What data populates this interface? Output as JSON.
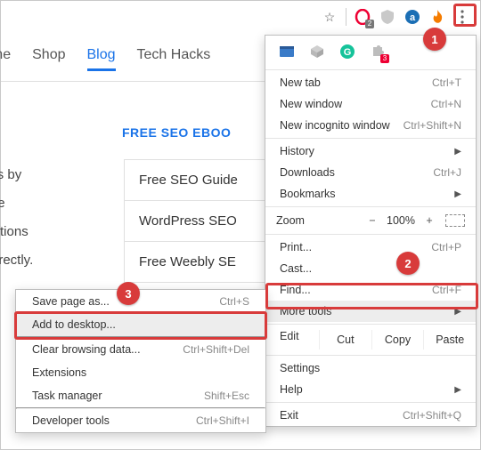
{
  "callouts": {
    "one": "1",
    "two": "2",
    "three": "3"
  },
  "toolbar": {
    "opera_badge": "2",
    "ext_badge": "3"
  },
  "nav": {
    "home": "ome",
    "shop": "Shop",
    "blog": "Blog",
    "hacks": "Tech Hacks"
  },
  "heading": "FREE SEO EBOO",
  "body": {
    "l1": "gers by",
    "l2": ". We",
    "l3": "tructions",
    "l4": "s directly."
  },
  "list": {
    "i1": "Free SEO Guide",
    "i2": "WordPress SEO",
    "i3": "Free Weebly SE"
  },
  "menu": {
    "new_tab": "New tab",
    "new_tab_sc": "Ctrl+T",
    "new_window": "New window",
    "new_window_sc": "Ctrl+N",
    "new_incognito": "New incognito window",
    "new_incognito_sc": "Ctrl+Shift+N",
    "history": "History",
    "downloads": "Downloads",
    "downloads_sc": "Ctrl+J",
    "bookmarks": "Bookmarks",
    "zoom": "Zoom",
    "zoom_minus": "−",
    "zoom_val": "100%",
    "zoom_plus": "+",
    "print": "Print...",
    "print_sc": "Ctrl+P",
    "cast": "Cast...",
    "find": "Find...",
    "find_sc": "Ctrl+F",
    "more_tools": "More tools",
    "edit": "Edit",
    "cut": "Cut",
    "copy": "Copy",
    "paste": "Paste",
    "settings": "Settings",
    "help": "Help",
    "exit": "Exit",
    "exit_sc": "Ctrl+Shift+Q"
  },
  "submenu": {
    "save_page": "Save page as...",
    "save_page_sc": "Ctrl+S",
    "add_desktop": "Add to desktop...",
    "clear_data": "Clear browsing data...",
    "clear_data_sc": "Ctrl+Shift+Del",
    "extensions": "Extensions",
    "task_mgr": "Task manager",
    "task_mgr_sc": "Shift+Esc",
    "dev_tools": "Developer tools",
    "dev_tools_sc": "Ctrl+Shift+I"
  }
}
